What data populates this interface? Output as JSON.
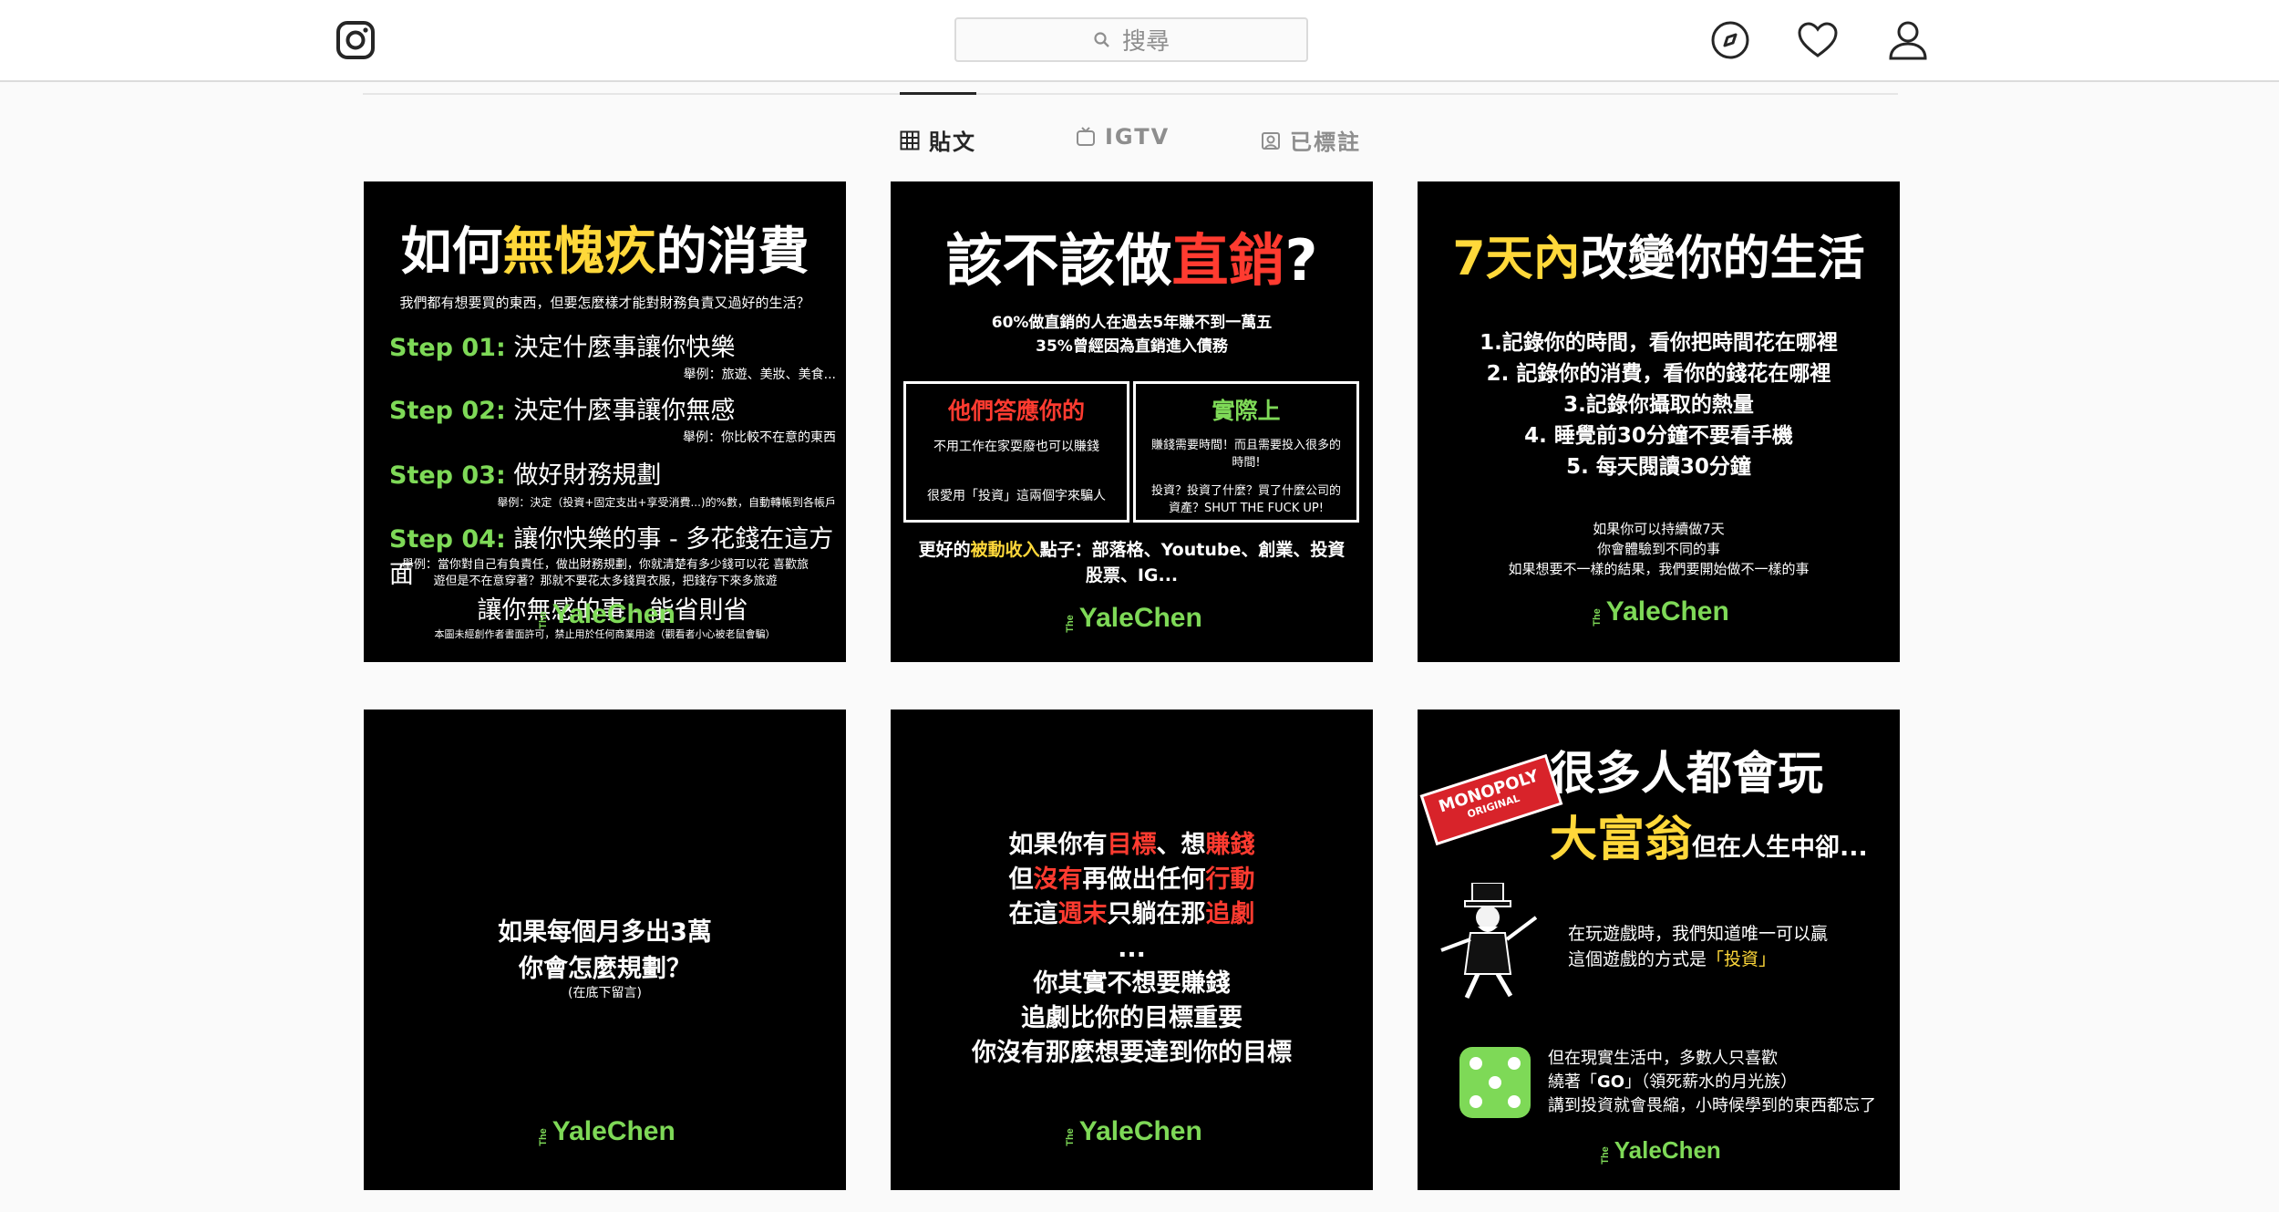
{
  "search": {
    "placeholder": "搜尋"
  },
  "tabs": [
    {
      "label": "貼文"
    },
    {
      "label": "IGTV"
    },
    {
      "label": "已標註"
    }
  ],
  "logo": {
    "the": "The",
    "yale": "Yale",
    "chen": "Chen"
  },
  "posts": [
    {
      "title_a": "如何",
      "title_b": "無愧疚",
      "title_c": "的消費",
      "subtitle": "我們都有想要買的東西，但要怎麼樣才能對財務負責又過好的生活？",
      "steps": [
        {
          "k": "Step 01:",
          "t": "決定什麼事讓你快樂",
          "n": "舉例：旅遊、美妝、美食..."
        },
        {
          "k": "Step 02:",
          "t": "決定什麼事讓你無感",
          "n": "舉例：你比較不在意的東西"
        },
        {
          "k": "Step 03:",
          "t": "做好財務規劃",
          "n": "舉例：決定（投資+固定支出+享受消費...)的%數，自動轉帳到各帳戶"
        },
        {
          "k": "Step 04:",
          "t": "讓你快樂的事 - 多花錢在這方面",
          "t2": "讓你無感的事 - 能省則省"
        }
      ],
      "note": "舉例：當你對自己有負責任，做出財務規劃，你就清楚有多少錢可以花 喜歡旅遊但是不在意穿著？那就不要花太多錢買衣服，把錢存下來多旅遊",
      "footer": "本圖未經創作者書面許可，禁止用於任何商業用途（觀看者小心被老鼠會騙）"
    },
    {
      "title_a": "該不該做",
      "title_b": "直銷",
      "title_c": "?",
      "line1": "60%做直銷的人在過去5年賺不到一萬五",
      "line2": "35%曾經因為直銷進入債務",
      "left_head": "他們答應你的",
      "left_1": "不用工作在家耍廢也可以賺錢",
      "left_2": "很愛用「投資」這兩個字來騙人",
      "right_head": "實際上",
      "right_1": "賺錢需要時間！而且需要投入很多的時間!",
      "right_2": "投資？投資了什麼？買了什麼公司的資產？SHUT THE FUCK UP!",
      "bottom_a": "更好的",
      "bottom_b": "被動收入",
      "bottom_c": "點子：部落格、Youtube、創業、投資股票、IG..."
    },
    {
      "title_a": "7天內",
      "title_b": "改變你的生活",
      "items": [
        "1.記錄你的時間，看你把時間花在哪裡",
        "2. 記錄你的消費，看你的錢花在哪裡",
        "3.記錄你攝取的熱量",
        "4. 睡覺前30分鐘不要看手機",
        "5. 每天閱讀30分鐘"
      ],
      "notes": [
        "如果你可以持續做7天",
        "你會體驗到不同的事",
        "如果想要不一樣的結果，我們要開始做不一樣的事"
      ]
    },
    {
      "line1": "如果每個月多出3萬",
      "line2": "你會怎麼規劃？",
      "line3": "(在底下留言)"
    },
    {
      "l1": [
        {
          "t": "如果你有",
          "c": ""
        },
        {
          "t": "目標",
          "c": "red"
        },
        {
          "t": "、想",
          "c": ""
        },
        {
          "t": "賺錢",
          "c": "red"
        }
      ],
      "l2": [
        {
          "t": "但",
          "c": ""
        },
        {
          "t": "沒有",
          "c": "red"
        },
        {
          "t": "再做出任何",
          "c": ""
        },
        {
          "t": "行動",
          "c": "red"
        }
      ],
      "l3": [
        {
          "t": "在這",
          "c": ""
        },
        {
          "t": "週末",
          "c": "red"
        },
        {
          "t": "只躺在那",
          "c": ""
        },
        {
          "t": "追劇",
          "c": "red"
        }
      ],
      "dots": "...",
      "l4": "你其實不想要賺錢",
      "l5": "追劇比你的目標重要",
      "l6": "你沒有那麼想要達到你的目標"
    },
    {
      "t1": "很多人都會玩",
      "t2": "大富翁",
      "t3": "但在人生中卻...",
      "badge1": "MONOPOLY",
      "badge2": "ORIGINAL",
      "p1": "在玩遊戲時，我們知道唯一可以贏",
      "p2a": "這個遊戲的方式是",
      "p2b": "「投資」",
      "q1": "但在現實生活中，多數人只喜歡",
      "q2a": "繞著「",
      "q2b": "GO",
      "q2c": "」（領死薪水的月光族）",
      "q3": "講到投資就會畏縮，小時候學到的東西都忘了"
    }
  ],
  "colors": {
    "accent_green": "#7ed957",
    "accent_red": "#ff3b30",
    "accent_yellow": "#ffd83a"
  }
}
